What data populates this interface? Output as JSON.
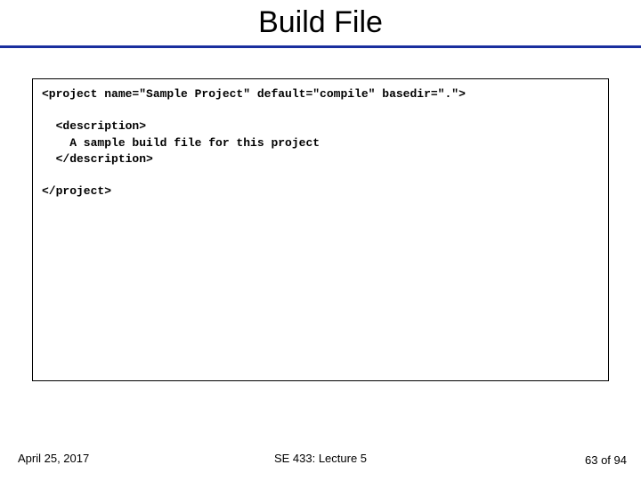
{
  "slide": {
    "title": "Build File"
  },
  "code": {
    "content": "<project name=\"Sample Project\" default=\"compile\" basedir=\".\">\n\n  <description>\n    A sample build file for this project\n  </description>\n\n</project>"
  },
  "footer": {
    "date": "April 25, 2017",
    "center": "SE 433: Lecture 5",
    "page_current": "63",
    "page_sep": " of ",
    "page_total": "94"
  }
}
